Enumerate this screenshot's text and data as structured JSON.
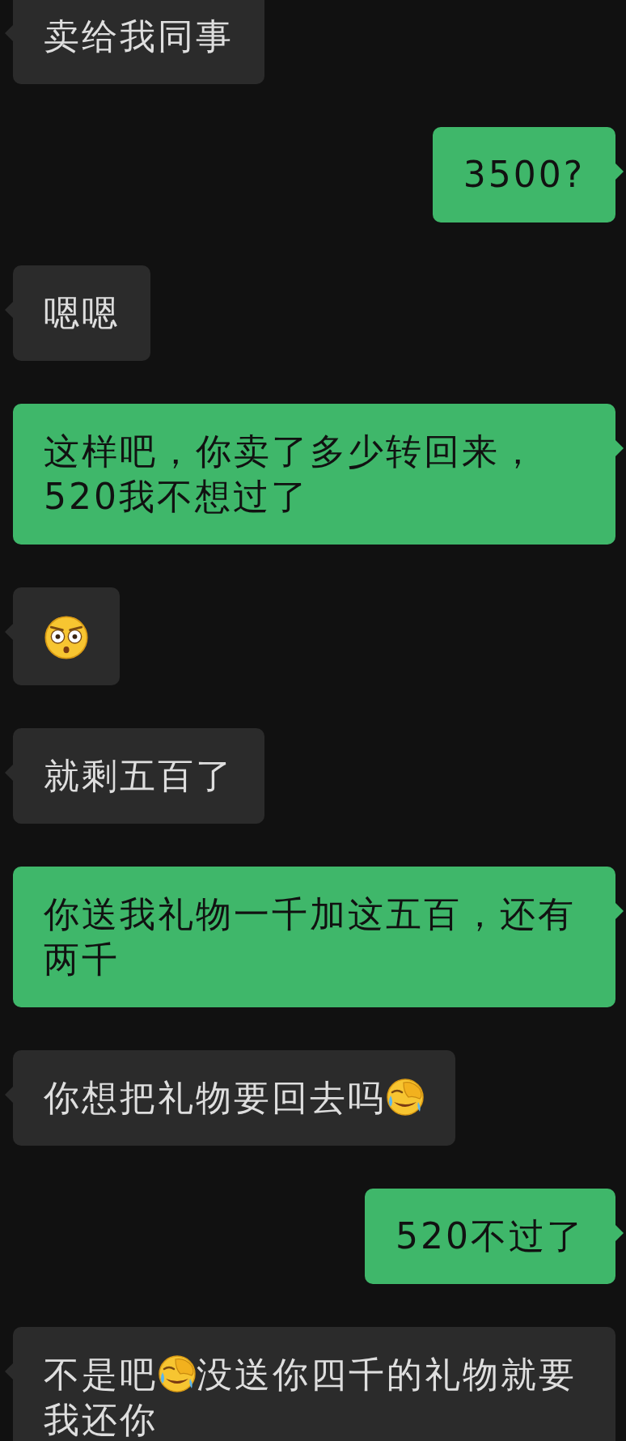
{
  "messages": [
    {
      "kind": "incoming",
      "parts": [
        {
          "kind": "text",
          "text": "卖给我同事"
        }
      ]
    },
    {
      "kind": "outgoing",
      "parts": [
        {
          "kind": "text",
          "text": "3500?"
        }
      ]
    },
    {
      "kind": "incoming",
      "parts": [
        {
          "kind": "text",
          "text": "嗯嗯"
        }
      ]
    },
    {
      "kind": "outgoing",
      "parts": [
        {
          "kind": "text",
          "text": "这样吧，你卖了多少转回来，520我不想过了"
        }
      ]
    },
    {
      "kind": "incoming",
      "parts": [
        {
          "kind": "stare-emoji"
        }
      ]
    },
    {
      "kind": "incoming",
      "parts": [
        {
          "kind": "text",
          "text": "就剩五百了"
        }
      ]
    },
    {
      "kind": "outgoing",
      "parts": [
        {
          "kind": "text",
          "text": "你送我礼物一千加这五百，还有两千"
        }
      ]
    },
    {
      "kind": "incoming",
      "parts": [
        {
          "kind": "text",
          "text": "你想把礼物要回去吗"
        },
        {
          "kind": "facepalm-emoji"
        }
      ]
    },
    {
      "kind": "outgoing",
      "parts": [
        {
          "kind": "text",
          "text": "520不过了"
        }
      ]
    },
    {
      "kind": "incoming",
      "parts": [
        {
          "kind": "text",
          "text": "不是吧"
        },
        {
          "kind": "facepalm-emoji"
        },
        {
          "kind": "text",
          "text": "没送你四千的礼物就要"
        },
        {
          "kind": "text",
          "text": "我还你"
        }
      ]
    }
  ]
}
